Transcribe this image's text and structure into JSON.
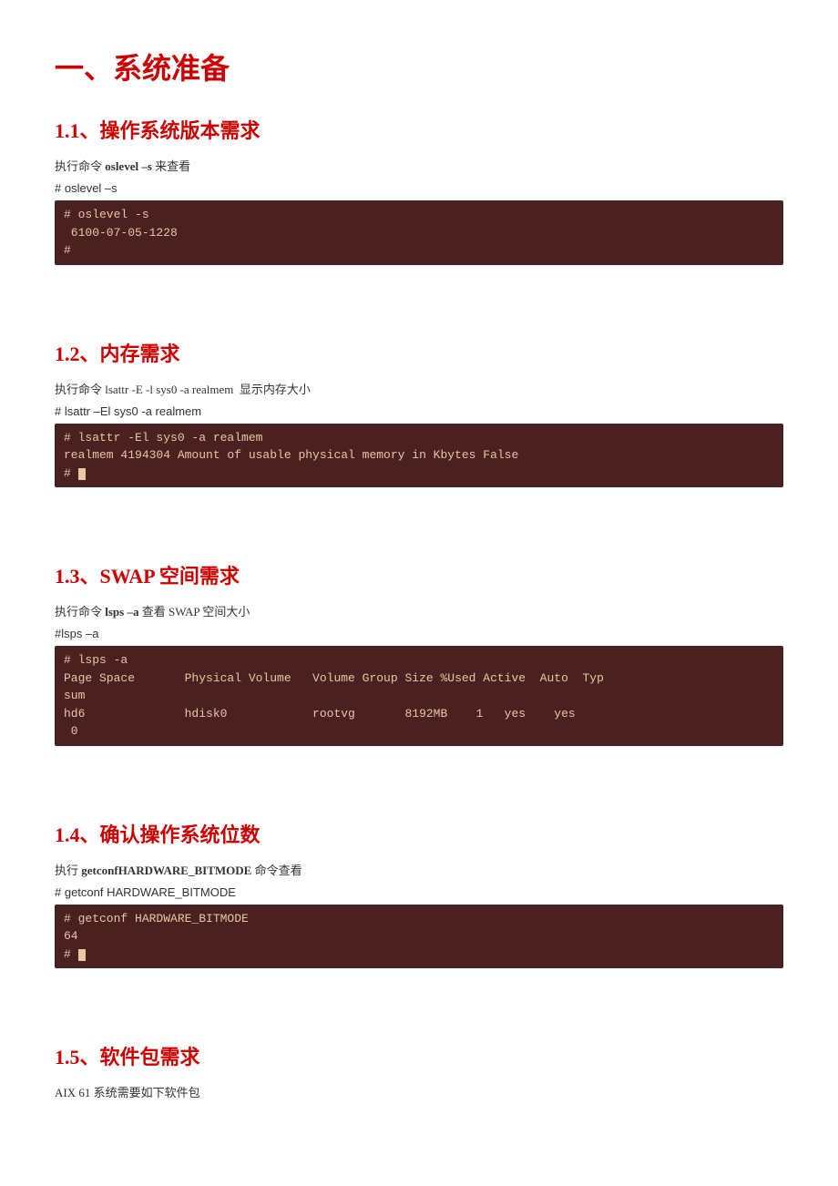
{
  "page": {
    "main_title": "一、系统准备",
    "sections": [
      {
        "id": "1.1",
        "title_prefix": "1.1",
        "title_suffix": "、操作系统版本需求",
        "description": "执行命令 oslevel –s 来查看",
        "description_bold": "oslevel –s",
        "command_label": "# oslevel –s",
        "terminal_lines": [
          "# oslevel -s",
          " 6100-07-05-1228",
          "#"
        ]
      },
      {
        "id": "1.2",
        "title_prefix": "1.2",
        "title_suffix": "、内存需求",
        "description": "执行命令 lsattr -E -l sys0 -a realmem  显示内存大小",
        "description_bold": "lsattr -E -l sys0 -a realmem",
        "command_label": "# lsattr –El sys0 -a realmem",
        "terminal_lines": [
          "# lsattr -El sys0 -a realmem",
          "realmem 4194304 Amount of usable physical memory in Kbytes False",
          "# █"
        ]
      },
      {
        "id": "1.3",
        "title_prefix": "1.3",
        "title_suffix": "、SWAP 空间需求",
        "description": "执行命令 lsps –a 查看 SWAP 空间大小",
        "description_bold": "lsps –a",
        "command_label": "#lsps –a",
        "terminal_lines": [
          "# lsps -a",
          "Page Space       Physical Volume   Volume Group Size %Used Active  Auto  Typ",
          "sum",
          "hd6              hdisk0            rootvg       8192MB    1   yes    yes",
          " 0"
        ]
      },
      {
        "id": "1.4",
        "title_prefix": "1.4",
        "title_suffix": "、确认操作系统位数",
        "description": "执行 getconfHARDWARE_BITMODE 命令查看",
        "description_bold": "getconfHARDWARE_BITMODE",
        "command_label": "# getconf HARDWARE_BITMODE",
        "terminal_lines": [
          "# getconf HARDWARE_BITMODE",
          "64",
          "# █"
        ]
      },
      {
        "id": "1.5",
        "title_prefix": "1.5",
        "title_suffix": "、软件包需求",
        "description": "AIX 61 系统需要如下软件包",
        "description_bold": ""
      }
    ]
  }
}
